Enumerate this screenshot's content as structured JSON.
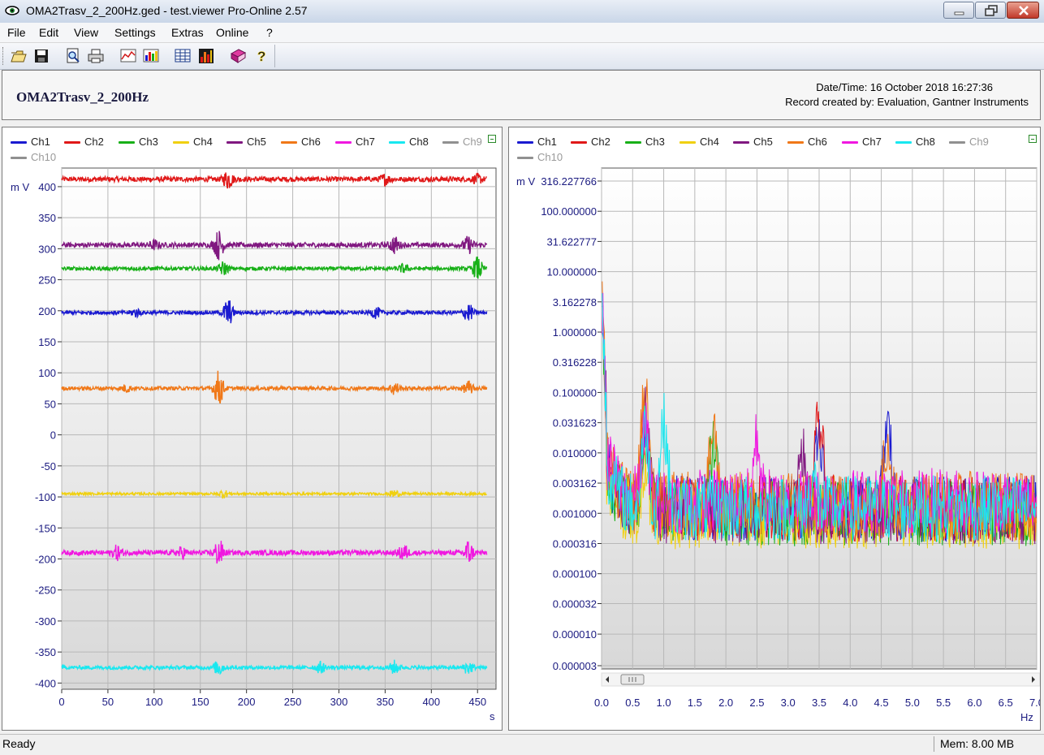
{
  "window": {
    "title": "OMA2Trasv_2_200Hz.ged - test.viewer Pro-Online 2.57"
  },
  "menu": [
    "File",
    "Edit",
    "View",
    "Settings",
    "Extras",
    "Online",
    "?"
  ],
  "toolbar": [
    "open-icon",
    "save-icon",
    "print-preview-icon",
    "print-icon",
    "line-chart-icon",
    "bar-chart-icon",
    "table-icon",
    "spectrum-icon",
    "book-icon",
    "help-icon"
  ],
  "header": {
    "name": "OMA2Trasv_2_200Hz",
    "datetime": "Date/Time: 16 October 2018 16:27:36",
    "created": "Record created by: Evaluation, Gantner Instruments"
  },
  "channels": [
    {
      "name": "Ch1",
      "color": "#1a1ad0"
    },
    {
      "name": "Ch2",
      "color": "#e01818"
    },
    {
      "name": "Ch3",
      "color": "#18b018"
    },
    {
      "name": "Ch4",
      "color": "#f0d010"
    },
    {
      "name": "Ch5",
      "color": "#801880"
    },
    {
      "name": "Ch6",
      "color": "#f07818"
    },
    {
      "name": "Ch7",
      "color": "#f018e0"
    },
    {
      "name": "Ch8",
      "color": "#18e8f0"
    },
    {
      "name": "Ch9",
      "color": "#909090"
    },
    {
      "name": "Ch10",
      "color": "#909090"
    }
  ],
  "chart_data": [
    {
      "type": "line",
      "ylabel": "m V",
      "xlabel": "s",
      "xlim": [
        0,
        470
      ],
      "ylim": [
        -410,
        430
      ],
      "xticks": [
        "0",
        "50",
        "100",
        "150",
        "200",
        "250",
        "300",
        "350",
        "400",
        "450"
      ],
      "yticks": [
        "400",
        "350",
        "300",
        "250",
        "200",
        "150",
        "100",
        "50",
        "0",
        "-50",
        "-100",
        "-150",
        "-200",
        "-250",
        "-300",
        "-350",
        "-400"
      ],
      "grid": true,
      "legend": "top",
      "series": [
        {
          "name": "Ch2",
          "color": "#e01818",
          "level": 412,
          "amp": 4,
          "bursts": [
            [
              180,
              14
            ],
            [
              350,
              7
            ],
            [
              450,
              6
            ]
          ]
        },
        {
          "name": "Ch5",
          "color": "#801880",
          "level": 306,
          "amp": 4,
          "bursts": [
            [
              170,
              22
            ],
            [
              360,
              12
            ],
            [
              440,
              12
            ],
            [
              100,
              6
            ]
          ]
        },
        {
          "name": "Ch3",
          "color": "#18b018",
          "level": 268,
          "amp": 3,
          "bursts": [
            [
              175,
              10
            ],
            [
              450,
              18
            ],
            [
              370,
              6
            ]
          ]
        },
        {
          "name": "Ch1",
          "color": "#1a1ad0",
          "level": 197,
          "amp": 3,
          "bursts": [
            [
              180,
              22
            ],
            [
              440,
              14
            ],
            [
              340,
              8
            ],
            [
              80,
              6
            ]
          ]
        },
        {
          "name": "Ch6",
          "color": "#f07818",
          "level": 75,
          "amp": 3,
          "bursts": [
            [
              170,
              28
            ],
            [
              360,
              10
            ],
            [
              440,
              10
            ],
            [
              70,
              5
            ]
          ]
        },
        {
          "name": "Ch4",
          "color": "#f0d010",
          "level": -95,
          "amp": 2,
          "bursts": [
            [
              175,
              6
            ],
            [
              360,
              6
            ]
          ]
        },
        {
          "name": "Ch7",
          "color": "#f018e0",
          "level": -190,
          "amp": 4,
          "bursts": [
            [
              170,
              20
            ],
            [
              370,
              12
            ],
            [
              440,
              18
            ],
            [
              60,
              10
            ],
            [
              130,
              8
            ]
          ]
        },
        {
          "name": "Ch8",
          "color": "#18e8f0",
          "level": -375,
          "amp": 3,
          "bursts": [
            [
              170,
              12
            ],
            [
              360,
              10
            ],
            [
              440,
              10
            ],
            [
              280,
              8
            ]
          ]
        }
      ]
    },
    {
      "type": "line",
      "ylabel": "m V",
      "xlabel": "Hz",
      "yscale": "log",
      "xlim": [
        0,
        7.0
      ],
      "xticks": [
        "0.0",
        "0.5",
        "1.0",
        "1.5",
        "2.0",
        "2.5",
        "3.0",
        "3.5",
        "4.0",
        "4.5",
        "5.0",
        "5.5",
        "6.0",
        "6.5",
        "7.0"
      ],
      "yticks": [
        "316.227766",
        "100.000000",
        "31.622777",
        "10.000000",
        "3.162278",
        "1.000000",
        "0.316228",
        "0.100000",
        "0.031623",
        "0.010000",
        "0.003162",
        "0.001000",
        "0.000316",
        "0.000100",
        "0.000032",
        "0.000010",
        "0.000003"
      ],
      "grid": true,
      "legend": "top",
      "series": [
        {
          "name": "Ch1",
          "color": "#1a1ad0",
          "peaks": [
            [
              0.7,
              0.03
            ],
            [
              4.6,
              0.035
            ],
            [
              3.5,
              0.02
            ]
          ]
        },
        {
          "name": "Ch2",
          "color": "#e01818",
          "peaks": [
            [
              3.5,
              0.04
            ],
            [
              0.7,
              0.02
            ]
          ]
        },
        {
          "name": "Ch3",
          "color": "#18b018",
          "peaks": [
            [
              0.7,
              0.03
            ],
            [
              1.8,
              0.02
            ]
          ]
        },
        {
          "name": "Ch4",
          "color": "#f0d010",
          "peaks": [
            [
              0.7,
              0.01
            ]
          ]
        },
        {
          "name": "Ch5",
          "color": "#801880",
          "peaks": [
            [
              0.7,
              0.05
            ],
            [
              3.2,
              0.02
            ]
          ]
        },
        {
          "name": "Ch6",
          "color": "#f07818",
          "peaks": [
            [
              0.7,
              0.1
            ],
            [
              1.8,
              0.03
            ],
            [
              4.6,
              0.02
            ]
          ]
        },
        {
          "name": "Ch7",
          "color": "#f018e0",
          "peaks": [
            [
              2.5,
              0.02
            ],
            [
              0.7,
              0.03
            ]
          ]
        },
        {
          "name": "Ch8",
          "color": "#18e8f0",
          "peaks": [
            [
              0.7,
              0.03
            ],
            [
              1.0,
              0.04
            ],
            [
              3.4,
              0.004
            ]
          ]
        }
      ]
    }
  ],
  "status": {
    "ready": "Ready",
    "mem": "Mem: 8.00 MB"
  }
}
